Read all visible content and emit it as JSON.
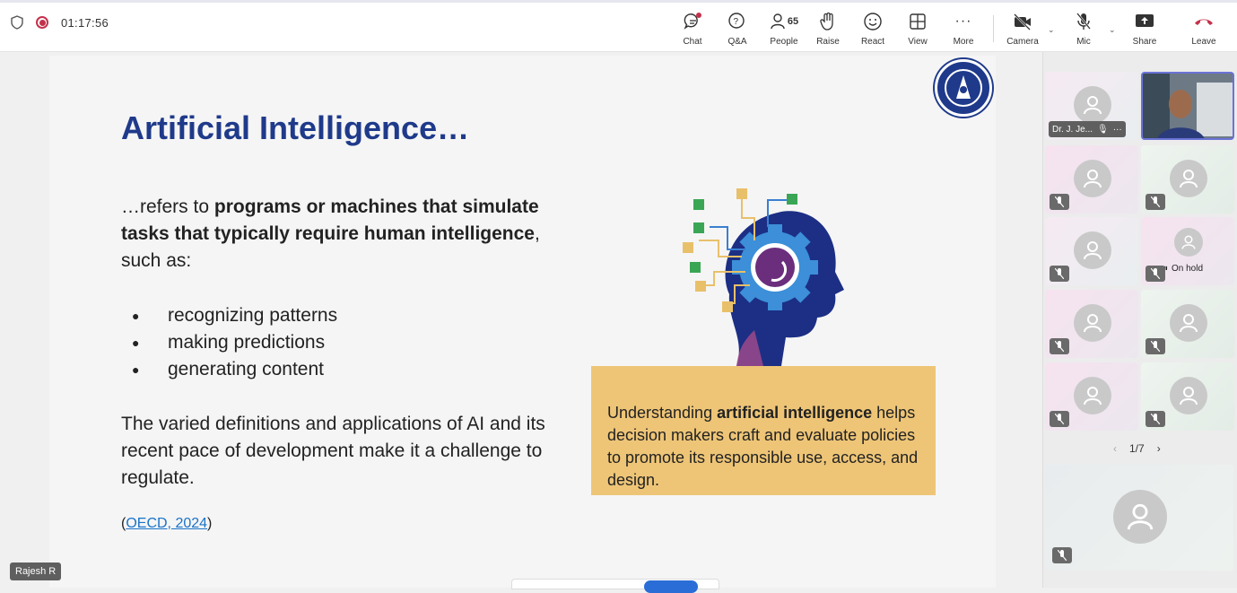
{
  "meeting": {
    "timer": "01:17:56"
  },
  "toolbar": {
    "chat": "Chat",
    "qa": "Q&A",
    "people": "People",
    "people_count": "65",
    "raise": "Raise",
    "react": "React",
    "view": "View",
    "more": "More",
    "camera": "Camera",
    "mic": "Mic",
    "share": "Share",
    "leave": "Leave",
    "leave_color": "#c4314b"
  },
  "slide": {
    "title": "Artificial Intelligence…",
    "para1_lead": "…refers to ",
    "para1_bold": "programs or machines that simulate tasks that typically require human intelligence",
    "para1_tail": ", such as:",
    "bullets": [
      "recognizing patterns",
      "making predictions",
      "generating content"
    ],
    "para2": "The varied definitions and applications of AI and its recent pace of development make it a challenge to regulate.",
    "cite_open": "(",
    "cite_link": "OECD, 2024",
    "cite_close": ")",
    "callout_lead": "Understanding ",
    "callout_bold": "artificial intelligence",
    "callout_tail": " helps decision makers craft and evaluate policies to promote its responsible use, access, and design.",
    "title_color": "#1f3a8a",
    "callout_color": "#eec577"
  },
  "presenter": {
    "name": "Rajesh R"
  },
  "gallery": {
    "first_tile_name": "Dr. J. Je...",
    "on_hold_label": "On hold",
    "pager": "1/7"
  }
}
